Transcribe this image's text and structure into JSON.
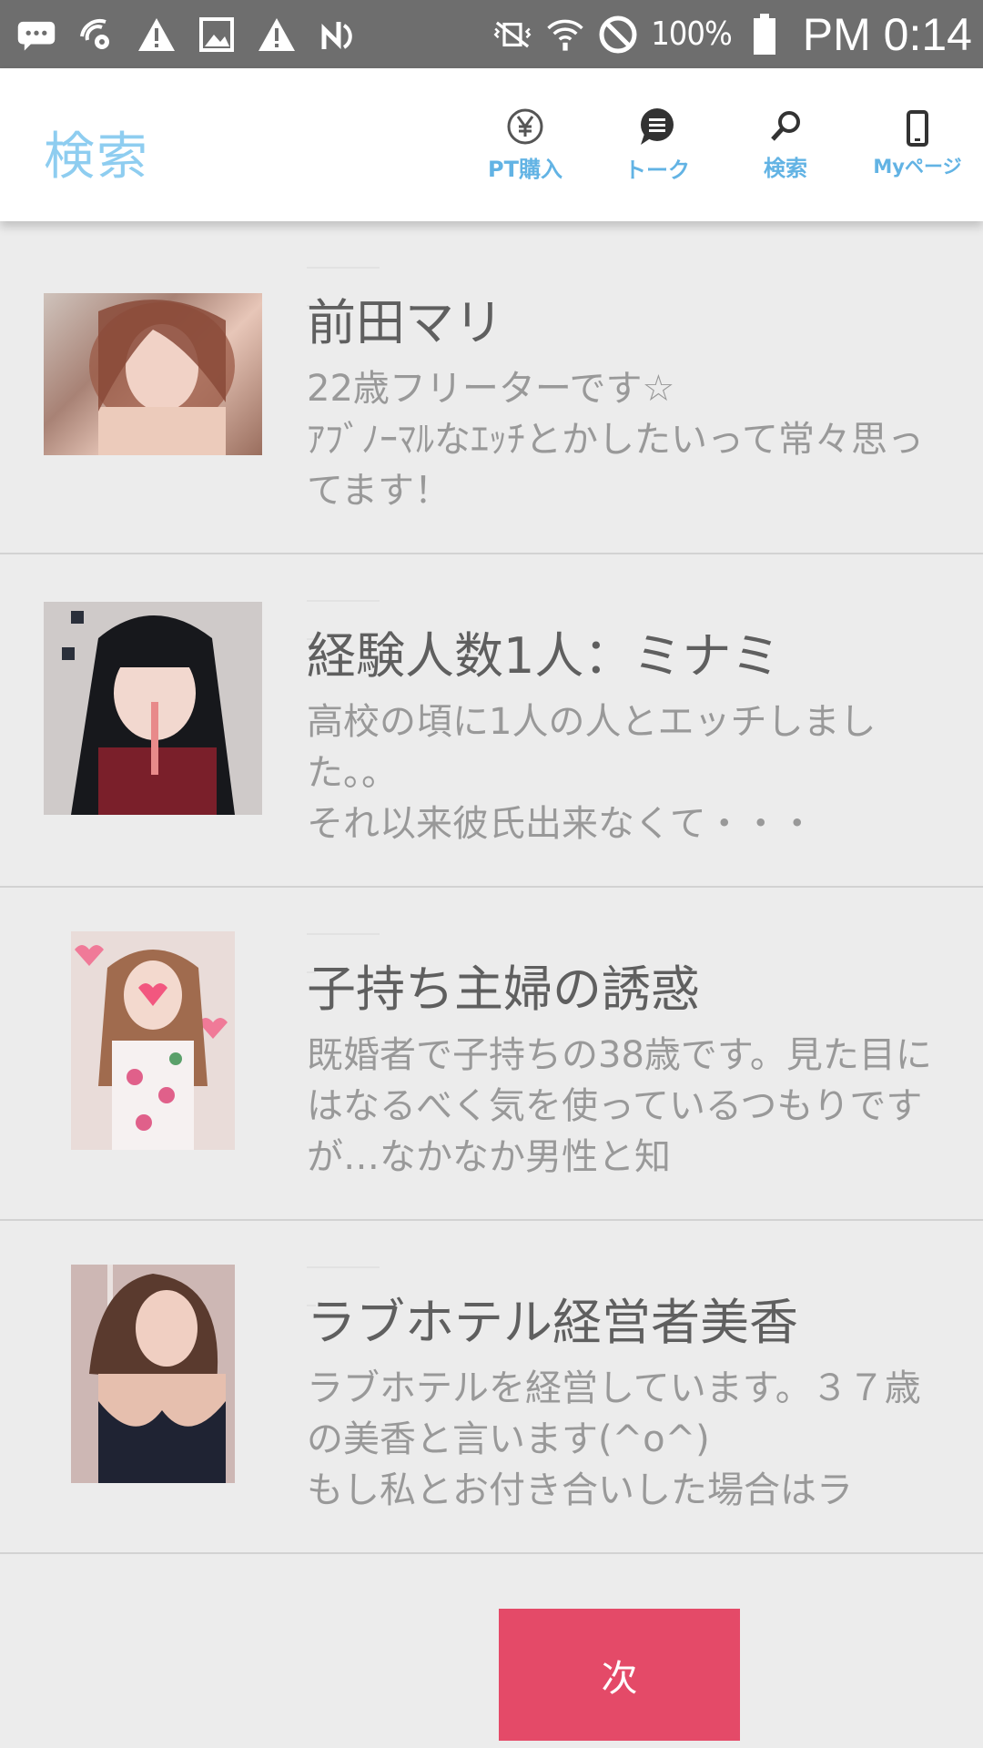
{
  "status_bar": {
    "icons": [
      "chat-bubble-icon",
      "wifi-settings-icon",
      "warning-icon",
      "image-icon",
      "warning-icon",
      "nfc-icon"
    ],
    "battery_percent": "100%",
    "time": "PM 0:14"
  },
  "header": {
    "title": "検索",
    "nav": [
      {
        "label": "PT購入",
        "icon": "yen-coin-icon"
      },
      {
        "label": "トーク",
        "icon": "chat-icon"
      },
      {
        "label": "検索",
        "icon": "magnifier-icon"
      },
      {
        "label": "Myページ",
        "icon": "phone-icon"
      }
    ]
  },
  "items": [
    {
      "title": "前田マリ",
      "description": "22歳フリーターです☆\nｱﾌﾞﾉｰﾏﾙなｴｯﾁとかしたいって常々思ってます！"
    },
    {
      "title": "経験人数1人：ミナミ",
      "description": "高校の頃に1人の人とエッチしました。。\nそれ以来彼氏出来なくて・・・"
    },
    {
      "title": "子持ち主婦の誘惑",
      "description": "既婚者で子持ちの38歳です。見た目にはなるべく気を使っているつもりですが…なかなか男性と知"
    },
    {
      "title": "ラブホテル経営者美香",
      "description": "ラブホテルを経営しています。３７歳の美香と言います(^o^)\nもし私とお付き合いした場合はラ"
    }
  ],
  "next_button": "次",
  "colors": {
    "accent_blue": "#8ecdf0",
    "nav_blue": "#62b3e4",
    "button_pink": "#e44a68",
    "background": "#ececec"
  }
}
